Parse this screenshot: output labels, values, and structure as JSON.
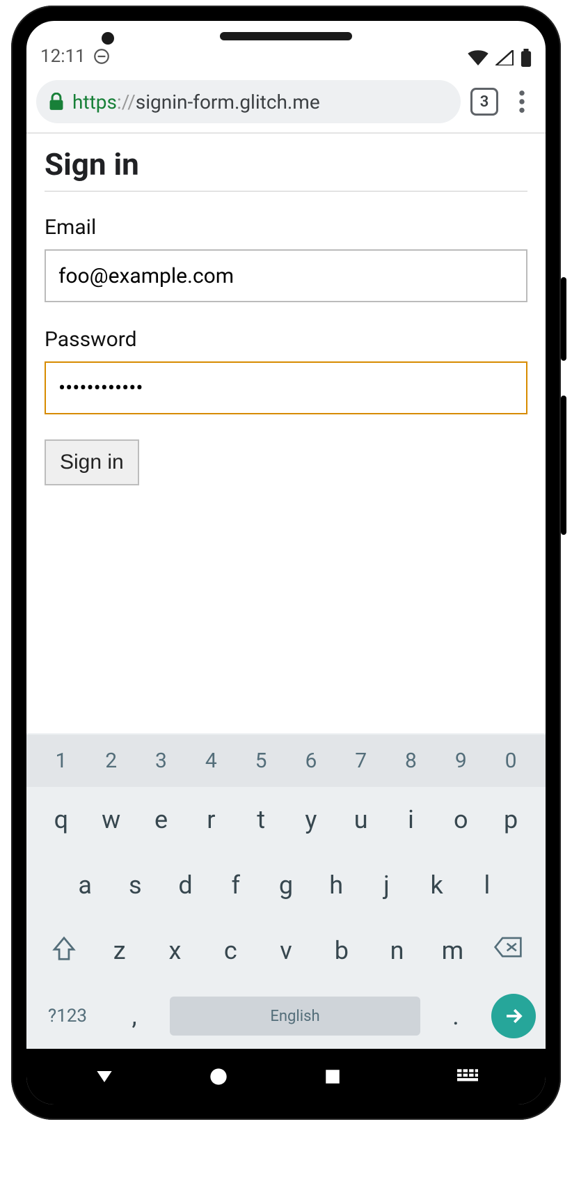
{
  "statusbar": {
    "time": "12:11"
  },
  "browser": {
    "url_scheme": "https",
    "url_sep": "://",
    "url_host": "signin-form.glitch.me",
    "tab_count": "3"
  },
  "page": {
    "title": "Sign in",
    "email_label": "Email",
    "email_value": "foo@example.com",
    "password_label": "Password",
    "password_value": "••••••••••••",
    "submit_label": "Sign in"
  },
  "keyboard": {
    "numrow": [
      "1",
      "2",
      "3",
      "4",
      "5",
      "6",
      "7",
      "8",
      "9",
      "0"
    ],
    "row1": [
      "q",
      "w",
      "e",
      "r",
      "t",
      "y",
      "u",
      "i",
      "o",
      "p"
    ],
    "row2": [
      "a",
      "s",
      "d",
      "f",
      "g",
      "h",
      "j",
      "k",
      "l"
    ],
    "row3": [
      "z",
      "x",
      "c",
      "v",
      "b",
      "n",
      "m"
    ],
    "symbols_label": "?123",
    "comma": ",",
    "space_label": "English",
    "period": "."
  }
}
